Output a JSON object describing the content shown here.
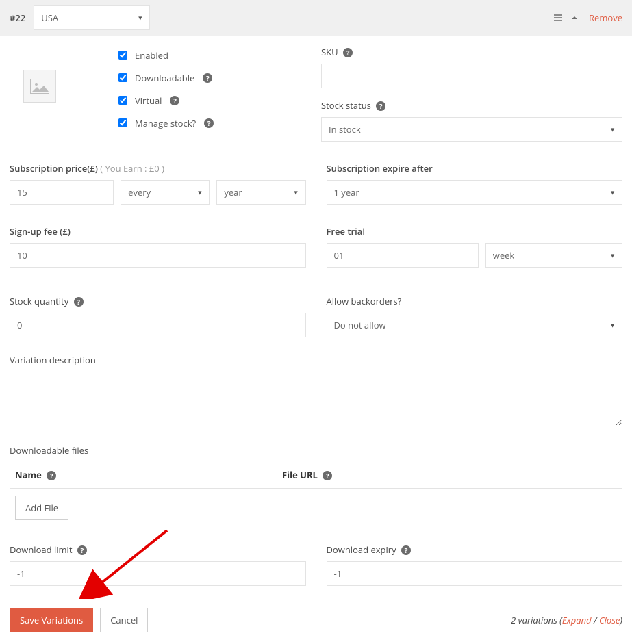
{
  "header": {
    "id": "#22",
    "variant": "USA",
    "remove": "Remove"
  },
  "checks": {
    "enabled": "Enabled",
    "downloadable": "Downloadable",
    "virtual": "Virtual",
    "manage_stock": "Manage stock?"
  },
  "sku": {
    "label": "SKU",
    "value": ""
  },
  "stock_status": {
    "label": "Stock status",
    "value": "In stock"
  },
  "price": {
    "label": "Subscription price(£)",
    "earn": "( You Earn : £0 )",
    "value": "15",
    "every": "every",
    "period": "year"
  },
  "expire": {
    "label": "Subscription expire after",
    "value": "1 year"
  },
  "signup": {
    "label": "Sign-up fee (£)",
    "value": "10"
  },
  "trial": {
    "label": "Free trial",
    "value": "01",
    "unit": "week"
  },
  "stock_qty": {
    "label": "Stock quantity",
    "value": "0"
  },
  "backorders": {
    "label": "Allow backorders?",
    "value": "Do not allow"
  },
  "description": {
    "label": "Variation description",
    "value": ""
  },
  "files": {
    "label": "Downloadable files",
    "name_col": "Name",
    "url_col": "File URL",
    "add": "Add File"
  },
  "dl_limit": {
    "label": "Download limit",
    "value": "-1"
  },
  "dl_expiry": {
    "label": "Download expiry",
    "value": "-1"
  },
  "footer": {
    "save": "Save Variations",
    "cancel": "Cancel",
    "count": "2 variations",
    "expand": "Expand",
    "close": "Close"
  }
}
